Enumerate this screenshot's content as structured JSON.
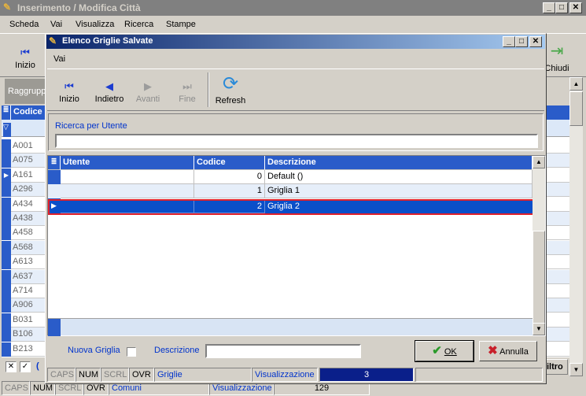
{
  "main_window": {
    "title": "Inserimento / Modifica Città",
    "menu": [
      "Scheda",
      "Vai",
      "Visualizza",
      "Ricerca",
      "Stampe"
    ],
    "toolbar": {
      "first": "Inizio",
      "close": "Chiudi"
    },
    "group_label": "Raggrupp",
    "grid_header": "Codice",
    "codes": [
      "A001",
      "A075",
      "A161",
      "A296",
      "A434",
      "A438",
      "A458",
      "A568",
      "A613",
      "A637",
      "A714",
      "A906",
      "B031",
      "B106",
      "B213"
    ],
    "bottom_label": "(",
    "filter_button": "iltro",
    "status": {
      "caps": "CAPS",
      "num": "NUM",
      "scrl": "SCRL",
      "ovr": "OVR",
      "table": "Comuni",
      "mode": "Visualizzazione",
      "count": "129"
    }
  },
  "dialog": {
    "title": "Elenco Griglie Salvate",
    "menu": [
      "Vai"
    ],
    "toolbar": {
      "first": "Inizio",
      "back": "Indietro",
      "next": "Avanti",
      "last": "Fine",
      "refresh": "Refresh"
    },
    "search": {
      "label": "Ricerca per  Utente",
      "value": ""
    },
    "grid": {
      "columns": [
        "Utente",
        "Codice",
        "Descrizione"
      ],
      "rows": [
        {
          "utente": "",
          "codice": "0",
          "descrizione": "Default ()"
        },
        {
          "utente": "",
          "codice": "1",
          "descrizione": "Griglia 1"
        },
        {
          "utente": "",
          "codice": "2",
          "descrizione": "Griglia 2"
        }
      ],
      "selected_index": 2
    },
    "footer": {
      "new_grid_label": "Nuova Griglia",
      "description_label": "Descrizione",
      "description_value": "",
      "ok": "OK",
      "cancel": "Annulla"
    },
    "status": {
      "caps": "CAPS",
      "num": "NUM",
      "scrl": "SCRL",
      "ovr": "OVR",
      "table": "Griglie",
      "mode": "Visualizzazione",
      "count": "3"
    }
  },
  "colors": {
    "title_active": "#0a246a",
    "header_blue": "#2a5cc9",
    "selection": "#0a4fc9",
    "highlight_border": "#e0202a"
  }
}
